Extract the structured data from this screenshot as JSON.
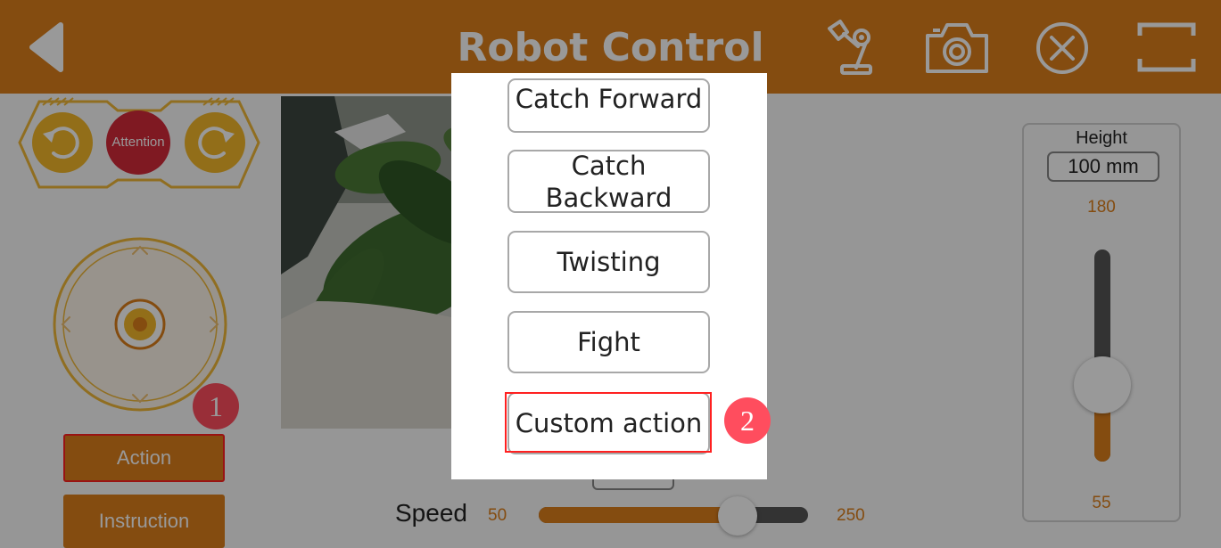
{
  "header": {
    "title": "Robot Control",
    "icons": [
      "back-arrow-icon",
      "robot-arm-icon",
      "camera-icon",
      "close-circle-icon",
      "fullscreen-icon"
    ]
  },
  "left_panel": {
    "attention_label": "Attention",
    "buttons": {
      "action": "Action",
      "instruction": "Instruction"
    }
  },
  "speed": {
    "label": "Speed",
    "min": "50",
    "max": "250",
    "value_fraction": 0.74
  },
  "height": {
    "label": "Height",
    "value": "100 mm",
    "max": "180",
    "min": "55",
    "value_fraction": 0.36
  },
  "dialog": {
    "options": [
      "Catch Forward",
      "Catch Backward",
      "Twisting",
      "Fight",
      "Custom action"
    ]
  },
  "annotations": {
    "badge_1": "1",
    "badge_2": "2"
  },
  "colors": {
    "accent": "#dc7f1c",
    "highlight_border": "#ff2020",
    "badge": "#ff4d5e",
    "attention": "#d42a3a"
  }
}
